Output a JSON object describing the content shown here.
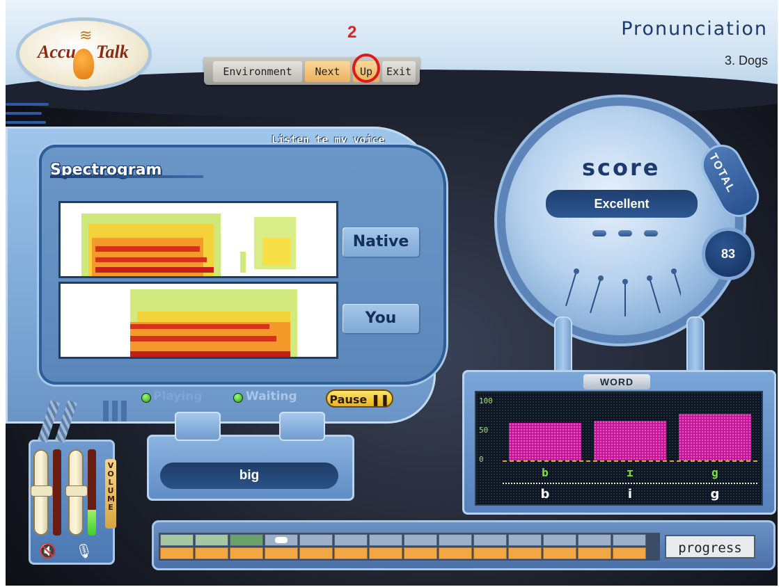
{
  "app": {
    "logo_text_left": "Accu",
    "logo_text_right": "Talk",
    "title": "Pronunciation",
    "lesson": "3. Dogs"
  },
  "nav": {
    "marker_number": "2",
    "items": [
      {
        "label": "Environment"
      },
      {
        "label": "Next"
      },
      {
        "label": "Up"
      },
      {
        "label": "Exit"
      }
    ]
  },
  "spectrogram": {
    "heading": "Spectrogram",
    "listen_label": "Listen te my voice",
    "native_button": "Native",
    "you_button": "You"
  },
  "playback": {
    "playing_label": "Playing",
    "waiting_label": "Waiting",
    "pause_label": "Pause"
  },
  "current_word": "big",
  "score": {
    "label": "score",
    "rating": "Excellent",
    "total_tab": "TOTAL",
    "total_value": "83"
  },
  "word_panel": {
    "title": "WORD",
    "chart_data": {
      "type": "bar",
      "categories": [
        "b",
        "ɪ",
        "g"
      ],
      "phonemes": [
        "b",
        "i",
        "g"
      ],
      "values": [
        64,
        68,
        80
      ],
      "ylim": [
        0,
        100
      ],
      "yticks": [
        "100",
        "50",
        "0"
      ]
    },
    "colors": {
      "bar": "#c01896",
      "ipa": "#7fe040",
      "baseline": "#f0a020"
    }
  },
  "volume": {
    "label": "VOLUME",
    "speaker_icon": "speaker-mute-icon",
    "mic_icon": "microphone-icon",
    "output_level": 0.0,
    "input_level": 0.3
  },
  "progress": {
    "label": "progress",
    "total_cells": 14,
    "completed": 3,
    "current_index": 3
  }
}
